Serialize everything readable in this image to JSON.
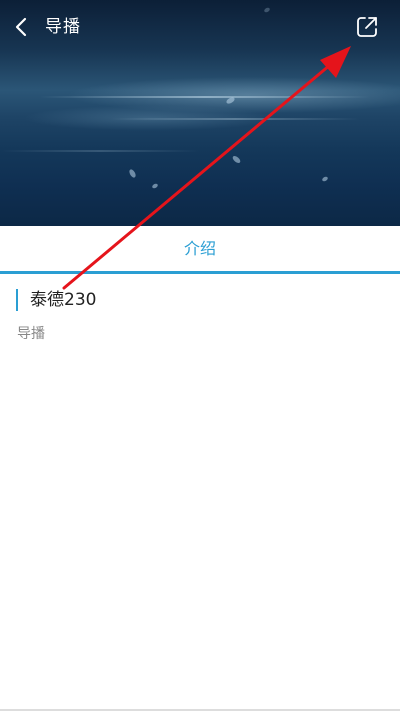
{
  "header": {
    "title": "导播",
    "back_icon": "chevron-left-icon",
    "share_icon": "share-external-icon"
  },
  "tabs": [
    {
      "label": "介绍",
      "active": true
    }
  ],
  "intro": {
    "heading": "泰德230",
    "subtext": "导播"
  },
  "colors": {
    "accent": "#2a9ed3",
    "annotation_arrow": "#e5141b"
  }
}
